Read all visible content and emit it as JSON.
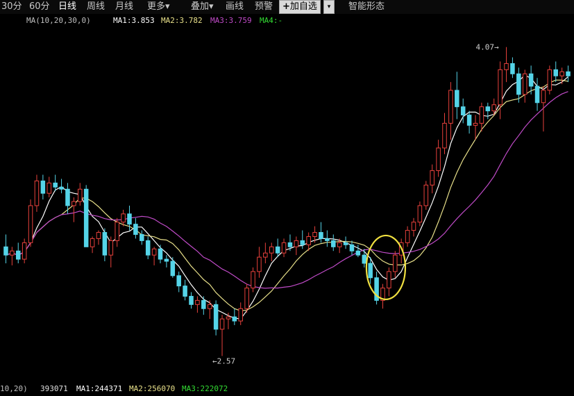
{
  "toolbar": {
    "items": [
      {
        "label": "30分"
      },
      {
        "label": "60分"
      },
      {
        "label": "日线"
      },
      {
        "label": "周线"
      },
      {
        "label": "月线"
      },
      {
        "label": "更多▾"
      },
      {
        "label": "叠加▾"
      },
      {
        "label": "画线"
      },
      {
        "label": "预警"
      },
      {
        "label": "智能形态"
      }
    ],
    "add_watchlist": "加自选",
    "add_watchlist_prefix": "+",
    "dropdown_glyph": "▾",
    "active_index": 2
  },
  "ma_legend": {
    "title": "MA(10,20,30,0)",
    "ma1": "MA1:3.853",
    "ma2": "MA2:3.782",
    "ma3": "MA3:3.759",
    "ma4": "MA4:-"
  },
  "vol_legend": {
    "title": "10,20)",
    "volume": "393071",
    "ma1": "MA1:244371",
    "ma2": "MA2:256070",
    "ma3": "MA3:222072"
  },
  "colors": {
    "background": "#000000",
    "up_candle": "#e8413c",
    "down_candle": "#55d4e8",
    "ma1": "#ffffff",
    "ma2": "#e8e08a",
    "ma3": "#c04bc8",
    "ma4": "#33dd33",
    "highlight_circle": "#f0e040"
  },
  "chart_data": {
    "type": "candlestick",
    "title": "",
    "ylim": [
      2.45,
      4.15
    ],
    "annotations": {
      "high_label": "4.07",
      "low_label": "2.57",
      "arrow_glyph": "←"
    },
    "highlight": "circle around breakout candles",
    "candles": [
      [
        3.1,
        3.16,
        3.02,
        3.06
      ],
      [
        3.06,
        3.1,
        3.01,
        3.08
      ],
      [
        3.08,
        3.12,
        3.02,
        3.04
      ],
      [
        3.04,
        3.14,
        3.02,
        3.12
      ],
      [
        3.12,
        3.33,
        3.1,
        3.3
      ],
      [
        3.3,
        3.45,
        3.27,
        3.42
      ],
      [
        3.42,
        3.45,
        3.33,
        3.36
      ],
      [
        3.36,
        3.44,
        3.34,
        3.41
      ],
      [
        3.41,
        3.45,
        3.37,
        3.39
      ],
      [
        3.39,
        3.43,
        3.36,
        3.38
      ],
      [
        3.38,
        3.41,
        3.26,
        3.3
      ],
      [
        3.3,
        3.34,
        3.22,
        3.32
      ],
      [
        3.32,
        3.41,
        3.3,
        3.38
      ],
      [
        3.38,
        3.4,
        3.1,
        3.1
      ],
      [
        3.1,
        3.15,
        3.07,
        3.14
      ],
      [
        3.14,
        3.18,
        3.11,
        3.17
      ],
      [
        3.17,
        3.19,
        3.03,
        3.06
      ],
      [
        3.06,
        3.15,
        3.0,
        3.13
      ],
      [
        3.13,
        3.24,
        3.1,
        3.22
      ],
      [
        3.22,
        3.28,
        3.2,
        3.26
      ],
      [
        3.26,
        3.3,
        3.18,
        3.21
      ],
      [
        3.21,
        3.24,
        3.14,
        3.16
      ],
      [
        3.16,
        3.18,
        3.11,
        3.13
      ],
      [
        3.13,
        3.15,
        3.04,
        3.06
      ],
      [
        3.06,
        3.1,
        3.01,
        3.09
      ],
      [
        3.09,
        3.11,
        3.02,
        3.04
      ],
      [
        3.04,
        3.06,
        3.0,
        3.03
      ],
      [
        3.03,
        3.05,
        2.95,
        2.96
      ],
      [
        2.96,
        2.98,
        2.88,
        2.91
      ],
      [
        2.91,
        2.94,
        2.84,
        2.86
      ],
      [
        2.86,
        2.88,
        2.8,
        2.82
      ],
      [
        2.82,
        2.86,
        2.78,
        2.84
      ],
      [
        2.84,
        2.86,
        2.77,
        2.8
      ],
      [
        2.8,
        2.84,
        2.75,
        2.82
      ],
      [
        2.82,
        2.84,
        2.67,
        2.7
      ],
      [
        2.7,
        2.77,
        2.57,
        2.75
      ],
      [
        2.75,
        2.78,
        2.7,
        2.76
      ],
      [
        2.76,
        2.8,
        2.72,
        2.74
      ],
      [
        2.74,
        2.83,
        2.72,
        2.8
      ],
      [
        2.8,
        2.92,
        2.78,
        2.9
      ],
      [
        2.9,
        3.0,
        2.88,
        2.98
      ],
      [
        2.98,
        3.1,
        2.95,
        3.05
      ],
      [
        3.05,
        3.12,
        3.02,
        3.07
      ],
      [
        3.07,
        3.12,
        3.03,
        3.1
      ],
      [
        3.1,
        3.14,
        3.05,
        3.07
      ],
      [
        3.07,
        3.14,
        3.05,
        3.12
      ],
      [
        3.12,
        3.16,
        3.08,
        3.1
      ],
      [
        3.1,
        3.15,
        3.06,
        3.13
      ],
      [
        3.13,
        3.18,
        3.09,
        3.11
      ],
      [
        3.11,
        3.17,
        3.08,
        3.15
      ],
      [
        3.15,
        3.2,
        3.12,
        3.17
      ],
      [
        3.17,
        3.22,
        3.12,
        3.14
      ],
      [
        3.14,
        3.18,
        3.1,
        3.13
      ],
      [
        3.13,
        3.16,
        3.08,
        3.1
      ],
      [
        3.1,
        3.14,
        3.07,
        3.12
      ],
      [
        3.12,
        3.15,
        3.09,
        3.11
      ],
      [
        3.11,
        3.13,
        3.06,
        3.08
      ],
      [
        3.08,
        3.11,
        3.05,
        3.06
      ],
      [
        3.06,
        3.09,
        3.0,
        3.02
      ],
      [
        3.02,
        3.05,
        2.92,
        2.95
      ],
      [
        2.95,
        2.98,
        2.82,
        2.84
      ],
      [
        2.84,
        2.92,
        2.8,
        2.9
      ],
      [
        2.9,
        3.0,
        2.86,
        2.98
      ],
      [
        2.98,
        3.08,
        2.95,
        3.06
      ],
      [
        3.06,
        3.14,
        3.02,
        3.12
      ],
      [
        3.12,
        3.2,
        3.1,
        3.18
      ],
      [
        3.18,
        3.24,
        3.15,
        3.22
      ],
      [
        3.22,
        3.32,
        3.2,
        3.3
      ],
      [
        3.3,
        3.42,
        3.28,
        3.4
      ],
      [
        3.4,
        3.5,
        3.36,
        3.47
      ],
      [
        3.47,
        3.62,
        3.44,
        3.58
      ],
      [
        3.58,
        3.75,
        3.55,
        3.7
      ],
      [
        3.7,
        3.9,
        3.62,
        3.86
      ],
      [
        3.86,
        3.95,
        3.72,
        3.78
      ],
      [
        3.78,
        3.82,
        3.7,
        3.74
      ],
      [
        3.74,
        3.76,
        3.65,
        3.69
      ],
      [
        3.69,
        3.74,
        3.62,
        3.7
      ],
      [
        3.7,
        3.8,
        3.66,
        3.78
      ],
      [
        3.78,
        3.8,
        3.72,
        3.76
      ],
      [
        3.76,
        3.82,
        3.74,
        3.79
      ],
      [
        3.79,
        4.0,
        3.72,
        3.96
      ],
      [
        3.96,
        4.07,
        3.9,
        3.99
      ],
      [
        3.99,
        4.02,
        3.92,
        3.94
      ],
      [
        3.94,
        3.97,
        3.8,
        3.84
      ],
      [
        3.84,
        3.96,
        3.8,
        3.94
      ],
      [
        3.94,
        3.98,
        3.84,
        3.88
      ],
      [
        3.88,
        3.92,
        3.76,
        3.8
      ],
      [
        3.8,
        3.88,
        3.66,
        3.86
      ],
      [
        3.86,
        3.98,
        3.84,
        3.96
      ],
      [
        3.96,
        4.0,
        3.9,
        3.93
      ],
      [
        3.93,
        3.97,
        3.89,
        3.95
      ],
      [
        3.95,
        3.98,
        3.9,
        3.93
      ]
    ]
  }
}
